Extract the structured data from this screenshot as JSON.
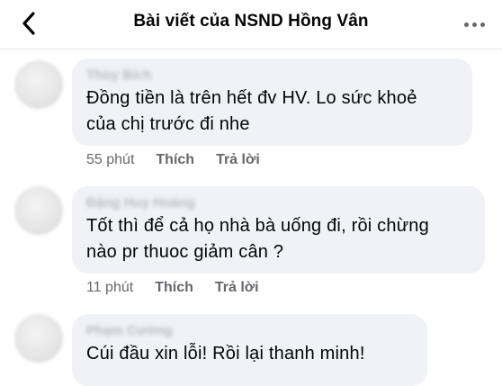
{
  "header": {
    "title": "Bài viết của NSND Hồng Vân",
    "back_icon": "chevron-left-icon",
    "more_icon": "more-horizontal-icon"
  },
  "comments": [
    {
      "author": "Thùy Bích",
      "text_lines": [
        "Đồng tiền là trên hết đv HV. Lo sức khoẻ",
        "của chị trước đi nhe"
      ],
      "time": "55 phút",
      "like_label": "Thích",
      "reply_label": "Trả lời"
    },
    {
      "author": "Đặng Huy Hoàng",
      "text_lines": [
        "Tốt thì để cả họ nhà bà uống đi, rồi chừng",
        "nào pr thuoc giảm cân ?"
      ],
      "time": "11 phút",
      "like_label": "Thích",
      "reply_label": "Trả lời"
    },
    {
      "author": "Phạm Cường",
      "text_lines": [
        "Cúi đầu xin lỗi! Rồi lại thanh minh!"
      ]
    }
  ]
}
